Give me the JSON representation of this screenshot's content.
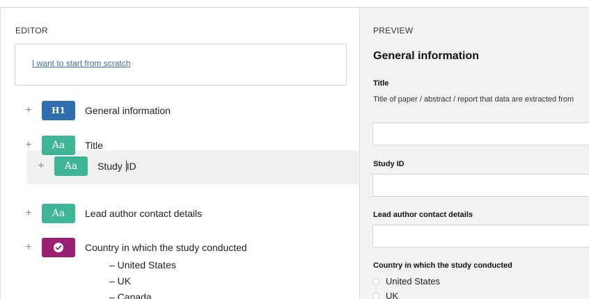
{
  "editor": {
    "title": "EDITOR",
    "scratch_link": "I want to start from scratch",
    "rows": [
      {
        "tag": "H1",
        "label": "General information"
      },
      {
        "tag": "Aa",
        "label": "Title"
      },
      {
        "tag": "Aa",
        "label": "Study ID"
      },
      {
        "tag": "Aa",
        "label": "Lead author contact details"
      },
      {
        "tag": "check-icon",
        "label": "Country in which the study conducted"
      }
    ],
    "options": [
      "– United States",
      "– UK",
      "– Canada"
    ],
    "colors": {
      "h1": "#2f6fb0",
      "text": "#3fb596",
      "choice": "#9b1f72"
    }
  },
  "preview": {
    "title": "PREVIEW",
    "heading": "General information",
    "fields": [
      {
        "label": "Title",
        "help": "Title of paper / abstract / report that data are extracted from"
      },
      {
        "label": "Study ID"
      },
      {
        "label": "Lead author contact details"
      },
      {
        "label": "Country in which the study conducted"
      }
    ],
    "options": [
      "United States",
      "UK"
    ]
  }
}
